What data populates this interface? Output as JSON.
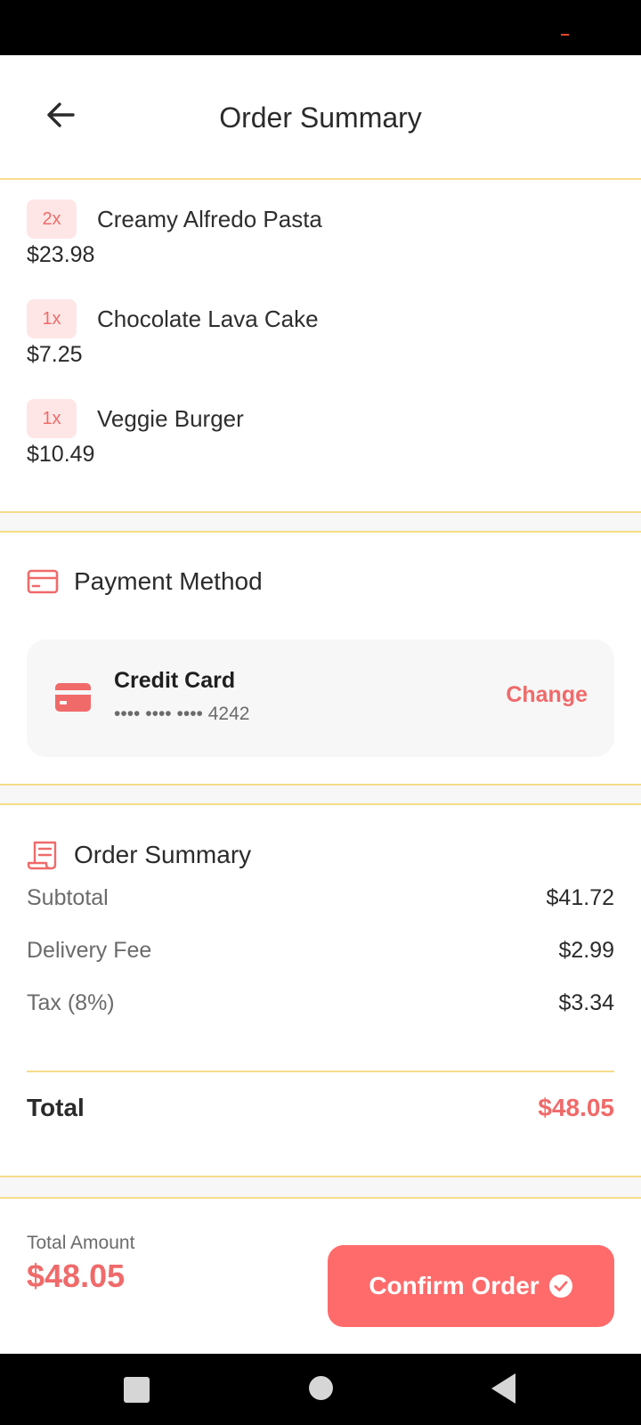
{
  "header": {
    "title": "Order Summary",
    "back_icon": "arrow-left-icon"
  },
  "items": [
    {
      "qty": "2x",
      "name": "Creamy Alfredo Pasta",
      "price": "$23.98"
    },
    {
      "qty": "1x",
      "name": "Chocolate Lava Cake",
      "price": "$7.25"
    },
    {
      "qty": "1x",
      "name": "Veggie Burger",
      "price": "$10.49"
    }
  ],
  "payment": {
    "title": "Payment Method",
    "icon": "credit-card-icon",
    "card_type": "Credit Card",
    "card_number": "•••• •••• •••• 4242",
    "change_label": "Change"
  },
  "summary": {
    "title": "Order Summary",
    "icon": "receipt-icon",
    "subtotal_label": "Subtotal",
    "subtotal_value": "$41.72",
    "delivery_label": "Delivery Fee",
    "delivery_value": "$2.99",
    "tax_label": "Tax (8%)",
    "tax_value": "$3.34",
    "total_label": "Total",
    "total_value": "$48.05"
  },
  "bottom": {
    "total_amount_label": "Total Amount",
    "total_amount_value": "$48.05",
    "confirm_label": "Confirm Order",
    "confirm_icon": "check-circle-icon"
  },
  "colors": {
    "accent": "#f06a6a",
    "button": "#ff6b6b",
    "divider": "#f6dc8a",
    "badge_bg": "#ffe6e6"
  },
  "nav": {
    "icons": [
      "recents-square-icon",
      "home-circle-icon",
      "back-triangle-icon"
    ]
  }
}
